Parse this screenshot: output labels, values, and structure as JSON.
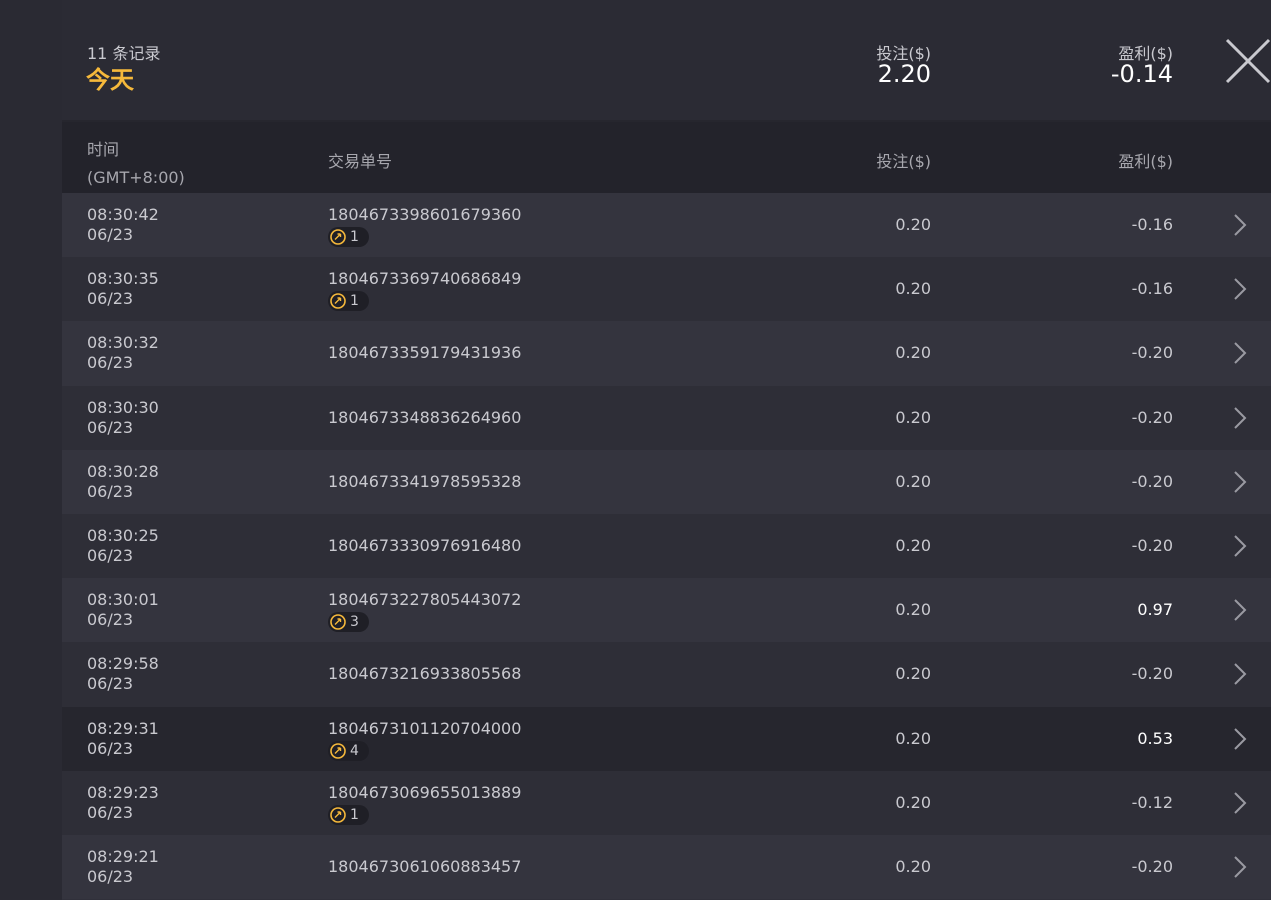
{
  "summary": {
    "record_count": "11 条记录",
    "date_label": "今天",
    "bet_label": "投注($)",
    "bet_total": "2.20",
    "profit_label": "盈利($)",
    "profit_total": "-0.14"
  },
  "table": {
    "headers": {
      "time": "时间",
      "timezone": "(GMT+8:00)",
      "order_id": "交易单号",
      "bet": "投注($)",
      "profit": "盈利($)"
    },
    "rows": [
      {
        "time": "08:30:42",
        "date": "06/23",
        "order_id": "1804673398601679360",
        "badge": "1",
        "bet": "0.20",
        "profit": "-0.16"
      },
      {
        "time": "08:30:35",
        "date": "06/23",
        "order_id": "1804673369740686849",
        "badge": "1",
        "bet": "0.20",
        "profit": "-0.16"
      },
      {
        "time": "08:30:32",
        "date": "06/23",
        "order_id": "1804673359179431936",
        "badge": "",
        "bet": "0.20",
        "profit": "-0.20"
      },
      {
        "time": "08:30:30",
        "date": "06/23",
        "order_id": "1804673348836264960",
        "badge": "",
        "bet": "0.20",
        "profit": "-0.20"
      },
      {
        "time": "08:30:28",
        "date": "06/23",
        "order_id": "1804673341978595328",
        "badge": "",
        "bet": "0.20",
        "profit": "-0.20"
      },
      {
        "time": "08:30:25",
        "date": "06/23",
        "order_id": "1804673330976916480",
        "badge": "",
        "bet": "0.20",
        "profit": "-0.20"
      },
      {
        "time": "08:30:01",
        "date": "06/23",
        "order_id": "1804673227805443072",
        "badge": "3",
        "bet": "0.20",
        "profit": "0.97"
      },
      {
        "time": "08:29:58",
        "date": "06/23",
        "order_id": "1804673216933805568",
        "badge": "",
        "bet": "0.20",
        "profit": "-0.20"
      },
      {
        "time": "08:29:31",
        "date": "06/23",
        "order_id": "1804673101120704000",
        "badge": "4",
        "bet": "0.20",
        "profit": "0.53"
      },
      {
        "time": "08:29:23",
        "date": "06/23",
        "order_id": "1804673069655013889",
        "badge": "1",
        "bet": "0.20",
        "profit": "-0.12"
      },
      {
        "time": "08:29:21",
        "date": "06/23",
        "order_id": "1804673061060883457",
        "badge": "",
        "bet": "0.20",
        "profit": "-0.20"
      }
    ]
  },
  "icons": {
    "close": "close-icon",
    "chevron": "chevron-right-icon",
    "free_spin": "free-spin-coin-icon"
  },
  "colors": {
    "accent": "#f6b93b",
    "text": "#c9c9cf",
    "positive": "#ffffff"
  }
}
